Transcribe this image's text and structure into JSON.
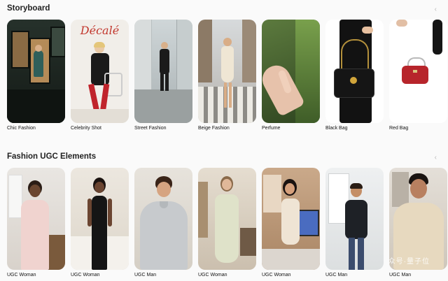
{
  "sections": [
    {
      "title": "Storyboard",
      "cards": [
        {
          "caption": "Chic Fashion"
        },
        {
          "caption": "Celebrity Shot",
          "overlay_text": "Décalé"
        },
        {
          "caption": "Street Fashion"
        },
        {
          "caption": "Beige Fashion"
        },
        {
          "caption": "Perfume"
        },
        {
          "caption": "Black Bag"
        },
        {
          "caption": "Red Bag"
        }
      ]
    },
    {
      "title": "Fashion UGC Elements",
      "cards": [
        {
          "caption": "UGC Woman"
        },
        {
          "caption": "UGC Woman"
        },
        {
          "caption": "UGC Man"
        },
        {
          "caption": "UGC Woman"
        },
        {
          "caption": "UGC Woman"
        },
        {
          "caption": "UGC Man"
        },
        {
          "caption": "UGC Man"
        }
      ]
    }
  ],
  "icons": {
    "scroll_left": "chevron-left-icon"
  },
  "watermark": "众号·量子位"
}
